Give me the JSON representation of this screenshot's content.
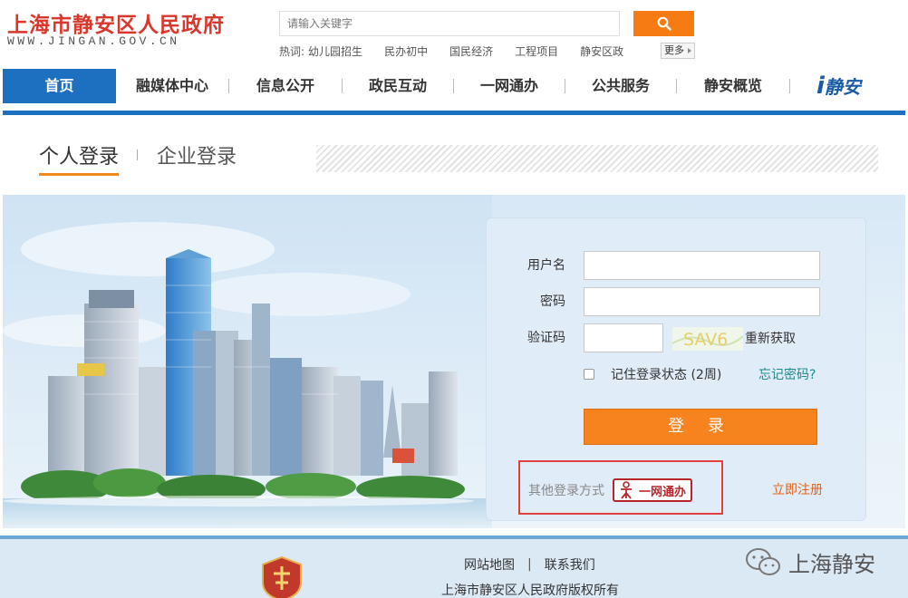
{
  "header": {
    "logo_cn": "上海市静安区人民政府",
    "logo_en": "WWW.JINGAN.GOV.CN",
    "search_placeholder": "请输入关键字",
    "hot_label": "热词:",
    "hot_words": [
      "幼儿园招生",
      "民办初中",
      "国民经济",
      "工程项目",
      "静安区政"
    ],
    "more_label": "更多"
  },
  "nav": {
    "items": [
      "首页",
      "融媒体中心",
      "信息公开",
      "政民互动",
      "一网通办",
      "公共服务",
      "静安概览"
    ],
    "brand": "静安"
  },
  "tabs": {
    "personal": "个人登录",
    "company": "企业登录"
  },
  "login": {
    "username_label": "用户名",
    "password_label": "密码",
    "captcha_label": "验证码",
    "captcha_text": "SAV6",
    "refresh_label": "重新获取",
    "remember_label": "记住登录状态 (2周)",
    "forgot_label": "忘记密码?",
    "submit_label": "登 录",
    "other_label": "其他登录方式",
    "ywtb_label": "一网通办",
    "register_label": "立即注册"
  },
  "footer": {
    "sitemap": "网站地图",
    "sep": "|",
    "contact": "联系我们",
    "copyright": "上海市静安区人民政府版权所有",
    "wechat_name": "上海静安"
  },
  "colors": {
    "brand_red": "#d9372b",
    "nav_blue": "#1d70c0",
    "accent_orange": "#f6831e"
  }
}
